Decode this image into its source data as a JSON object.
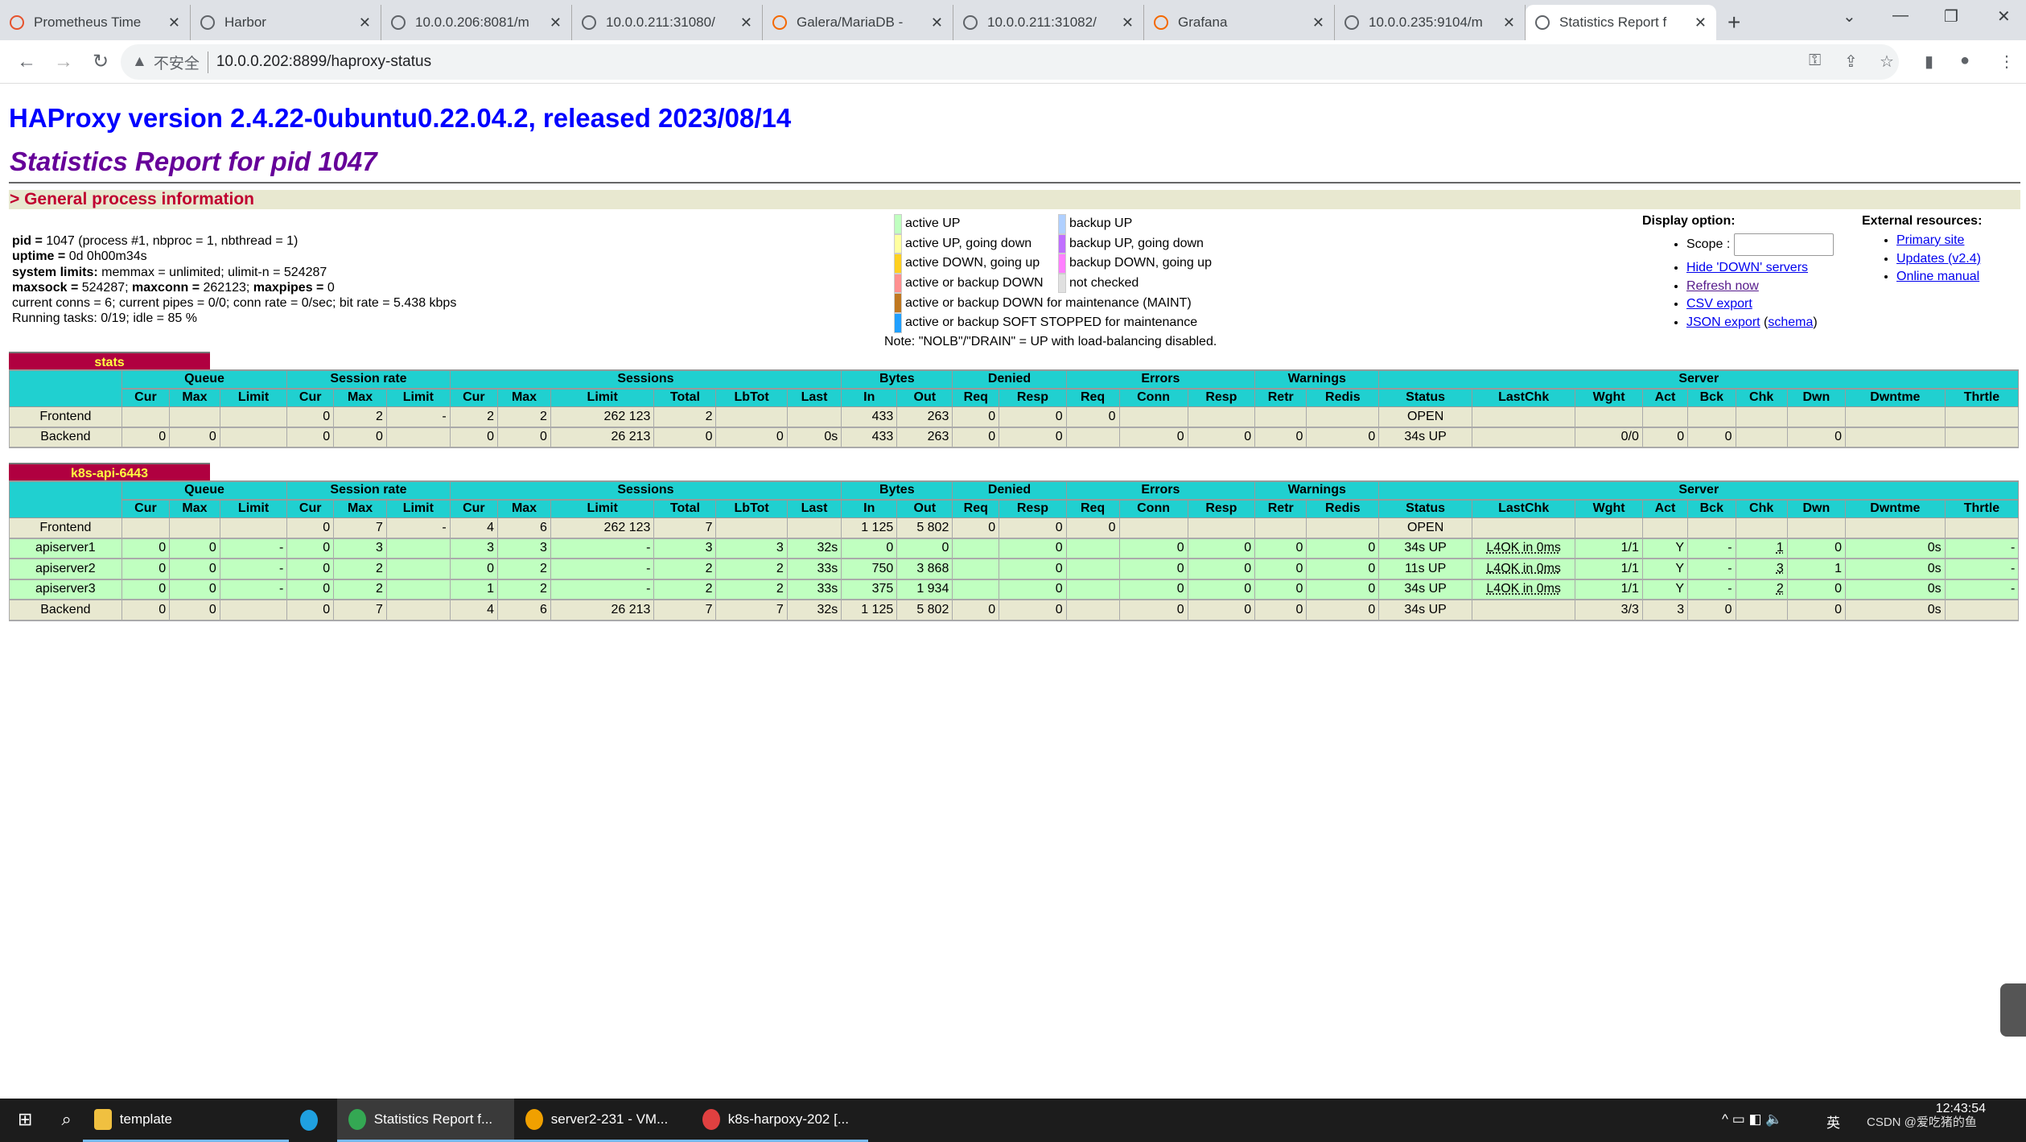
{
  "browser": {
    "tabs": [
      {
        "title": "Prometheus Time",
        "icon": "prometheus-icon",
        "color": "#e6522c"
      },
      {
        "title": "Harbor",
        "icon": "harbor-icon",
        "color": "#5f6368"
      },
      {
        "title": "10.0.0.206:8081/m",
        "icon": "globe-icon",
        "color": "#5f6368"
      },
      {
        "title": "10.0.0.211:31080/",
        "icon": "globe-icon",
        "color": "#5f6368"
      },
      {
        "title": "Galera/MariaDB -",
        "icon": "grafana-icon",
        "color": "#f46800"
      },
      {
        "title": "10.0.0.211:31082/",
        "icon": "globe-icon",
        "color": "#5f6368"
      },
      {
        "title": "Grafana",
        "icon": "grafana-icon",
        "color": "#f46800"
      },
      {
        "title": "10.0.0.235:9104/m",
        "icon": "globe-icon",
        "color": "#5f6368"
      },
      {
        "title": "Statistics Report f",
        "icon": "globe-icon",
        "color": "#5f6368",
        "active": true
      }
    ],
    "insecure_label": "不安全",
    "url": "10.0.0.202:8899/haproxy-status"
  },
  "page": {
    "title": "HAProxy version 2.4.22-0ubuntu0.22.04.2, released 2023/08/14",
    "subtitle": "Statistics Report for pid 1047",
    "section": "> General process information",
    "info": [
      {
        "b": "pid = ",
        "t": "1047 (process #1, nbproc = 1, nbthread = 1)"
      },
      {
        "b": "uptime = ",
        "t": "0d 0h00m34s"
      },
      {
        "b": "system limits:",
        "t": " memmax = unlimited; ulimit-n = 524287"
      },
      {
        "b": "maxsock = ",
        "t": "524287; ",
        "b2": "maxconn = ",
        "t2": "262123; ",
        "b3": "maxpipes = ",
        "t3": "0"
      },
      {
        "t": "current conns = 6; current pipes = 0/0; conn rate = 0/sec; bit rate = 5.438 kbps"
      },
      {
        "t": "Running tasks: 0/19; idle = 85 %"
      }
    ],
    "legend": {
      "left": [
        {
          "label": "active UP",
          "color": "#c0ffc0"
        },
        {
          "label": "active UP, going down",
          "color": "#ffffa0"
        },
        {
          "label": "active DOWN, going up",
          "color": "#ffd020"
        },
        {
          "label": "active or backup DOWN",
          "color": "#ff9090"
        }
      ],
      "right": [
        {
          "label": "backup UP",
          "color": "#b0d0ff"
        },
        {
          "label": "backup UP, going down",
          "color": "#c070ff"
        },
        {
          "label": "backup DOWN, going up",
          "color": "#ff80ff"
        },
        {
          "label": "not checked",
          "color": "#e0e0e0"
        }
      ],
      "wide": [
        {
          "label": "active or backup DOWN for maintenance (MAINT)",
          "color": "#c07820"
        },
        {
          "label": "active or backup SOFT STOPPED for maintenance",
          "color": "#20a0ff"
        }
      ],
      "note": "Note: \"NOLB\"/\"DRAIN\" = UP with load-balancing disabled."
    },
    "display": {
      "title": "Display option:",
      "scope": "Scope :",
      "hide": "Hide 'DOWN' servers",
      "refresh": "Refresh now",
      "csv": "CSV export",
      "json": "JSON export",
      "schema": "schema"
    },
    "external": {
      "title": "External resources:",
      "primary": "Primary site",
      "updates": "Updates (v2.4)",
      "manual": "Online manual"
    }
  },
  "groups": [
    [
      "",
      1
    ],
    [
      "Queue",
      3
    ],
    [
      "Session rate",
      3
    ],
    [
      "Sessions",
      6
    ],
    [
      "Bytes",
      2
    ],
    [
      "Denied",
      2
    ],
    [
      "Errors",
      3
    ],
    [
      "Warnings",
      2
    ],
    [
      "Server",
      9
    ]
  ],
  "columns": [
    "",
    "Cur",
    "Max",
    "Limit",
    "Cur",
    "Max",
    "Limit",
    "Cur",
    "Max",
    "Limit",
    "Total",
    "LbTot",
    "Last",
    "In",
    "Out",
    "Req",
    "Resp",
    "Req",
    "Conn",
    "Resp",
    "Retr",
    "Redis",
    "Status",
    "LastChk",
    "Wght",
    "Act",
    "Bck",
    "Chk",
    "Dwn",
    "Dwntme",
    "Thrtle"
  ],
  "proxies": [
    {
      "name": "stats",
      "rows": [
        {
          "type": "fe",
          "cells": [
            "Frontend",
            "",
            "",
            "",
            "0",
            "2",
            "-",
            "2",
            "2",
            "262 123",
            "2",
            "",
            "",
            "433",
            "263",
            "0",
            "0",
            "0",
            "",
            "",
            "",
            "",
            "OPEN",
            "",
            "",
            "",
            "",
            "",
            "",
            "",
            ""
          ]
        },
        {
          "type": "be",
          "cells": [
            "Backend",
            "0",
            "0",
            "",
            "0",
            "0",
            "",
            "0",
            "0",
            "26 213",
            "0",
            "0",
            "0s",
            "433",
            "263",
            "0",
            "0",
            "",
            "0",
            "0",
            "0",
            "0",
            "34s UP",
            "",
            "0/0",
            "0",
            "0",
            "",
            "0",
            "",
            ""
          ]
        }
      ]
    },
    {
      "name": "k8s-api-6443",
      "rows": [
        {
          "type": "fe",
          "cells": [
            "Frontend",
            "",
            "",
            "",
            "0",
            "7",
            "-",
            "4",
            "6",
            "262 123",
            "7",
            "",
            "",
            "1 125",
            "5 802",
            "0",
            "0",
            "0",
            "",
            "",
            "",
            "",
            "OPEN",
            "",
            "",
            "",
            "",
            "",
            "",
            "",
            ""
          ]
        },
        {
          "type": "up",
          "cells": [
            "apiserver1",
            "0",
            "0",
            "-",
            "0",
            "3",
            "",
            "3",
            "3",
            "-",
            "3",
            "3",
            "32s",
            "0",
            "0",
            "",
            "0",
            "",
            "0",
            "0",
            "0",
            "0",
            "34s UP",
            "L4OK in 0ms",
            "1/1",
            "Y",
            "-",
            "1",
            "0",
            "0s",
            "-"
          ]
        },
        {
          "type": "up",
          "cells": [
            "apiserver2",
            "0",
            "0",
            "-",
            "0",
            "2",
            "",
            "0",
            "2",
            "-",
            "2",
            "2",
            "33s",
            "750",
            "3 868",
            "",
            "0",
            "",
            "0",
            "0",
            "0",
            "0",
            "11s UP",
            "L4OK in 0ms",
            "1/1",
            "Y",
            "-",
            "3",
            "1",
            "0s",
            "-"
          ]
        },
        {
          "type": "up",
          "cells": [
            "apiserver3",
            "0",
            "0",
            "-",
            "0",
            "2",
            "",
            "1",
            "2",
            "-",
            "2",
            "2",
            "33s",
            "375",
            "1 934",
            "",
            "0",
            "",
            "0",
            "0",
            "0",
            "0",
            "34s UP",
            "L4OK in 0ms",
            "1/1",
            "Y",
            "-",
            "2",
            "0",
            "0s",
            "-"
          ]
        },
        {
          "type": "be",
          "cells": [
            "Backend",
            "0",
            "0",
            "",
            "0",
            "7",
            "",
            "4",
            "6",
            "26 213",
            "7",
            "7",
            "32s",
            "1 125",
            "5 802",
            "0",
            "0",
            "",
            "0",
            "0",
            "0",
            "0",
            "34s UP",
            "",
            "3/3",
            "3",
            "0",
            "",
            "0",
            "0s",
            ""
          ]
        }
      ]
    }
  ],
  "colors": {
    "header": "#20d0d0",
    "title_bg": "#b00040",
    "title_fg": "#ffff40",
    "frontend": "#e8e8d0",
    "active_up": "#c0ffc0"
  },
  "taskbar": {
    "items": [
      {
        "label": "template",
        "icon": "folder-icon"
      },
      {
        "label": "",
        "icon": "edge-icon"
      },
      {
        "label": "Statistics Report f...",
        "icon": "chrome-icon",
        "active": true
      },
      {
        "label": "server2-231 - VM...",
        "icon": "vmware-icon"
      },
      {
        "label": "k8s-harpoxy-202 [...",
        "icon": "putty-icon"
      }
    ],
    "ime": "英",
    "time": "12:43:54",
    "watermark": "CSDN @爱吃猪的鱼"
  }
}
